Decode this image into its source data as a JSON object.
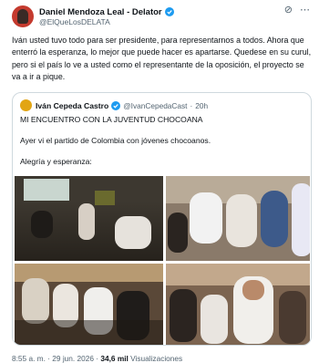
{
  "author": {
    "name": "Daniel Mendoza Leal - Delator",
    "handle": "@ElQueLosDELATA"
  },
  "tweet_text": "Iván usted tuvo todo para ser presidente, para representarnos a todos. Ahora que enterró la esperanza, lo mejor que puede hacer es apartarse. Quedese en su curul, pero si el país lo ve a usted como el representante de la oposición, el proyecto se va a ir a pique.",
  "quoted": {
    "name": "Iván Cepeda Castro",
    "handle": "@IvanCepedaCast",
    "separator": "·",
    "time": "20h",
    "line1": "MI ENCUENTRO CON LA JUVENTUD CHOCOANA",
    "line2": "Ayer vi el partido de Colombia con jóvenes chocoanos.",
    "line3": "Alegría y esperanza:"
  },
  "meta": {
    "time": "8:55 a. m.",
    "dot1": "·",
    "date": "29 jun. 2026",
    "dot2": "·",
    "views": "34,6 mil",
    "views_label": "Visualizaciones"
  },
  "icons": {
    "top_right": [
      "grok-icon",
      "more-icon"
    ],
    "verified": "verified-badge-icon"
  },
  "colors": {
    "verified": "#1d9bf0",
    "secondary_text": "#536471",
    "border": "#cfd9de"
  }
}
